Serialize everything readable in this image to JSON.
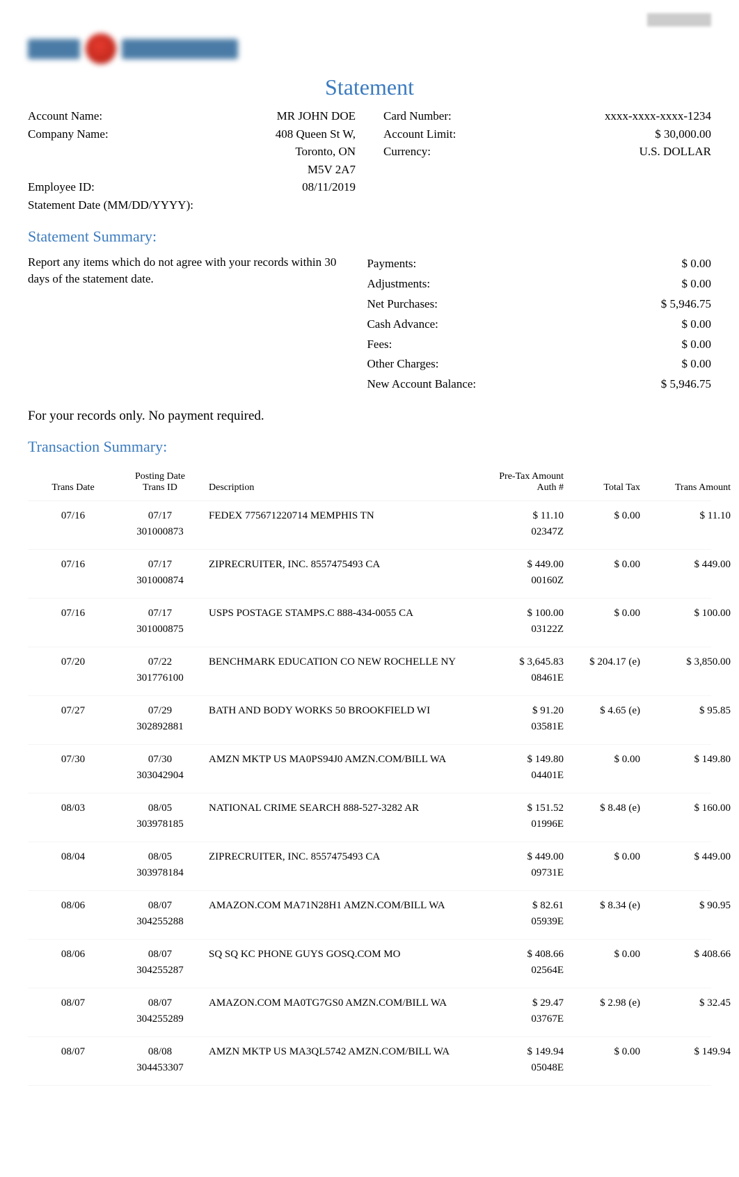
{
  "top_right_blurred": "x: redacted-url",
  "logo_text_left": "Blur",
  "logo_text_right": "Financial Group",
  "title": "Statement",
  "account_info_left": [
    {
      "label": "Account Name:",
      "value_lines": [
        "MR JOHN DOE"
      ]
    },
    {
      "label": "Company Name:",
      "value_lines": [
        "408 Queen St W,",
        "Toronto, ON",
        "M5V 2A7"
      ]
    },
    {
      "label": "Employee ID:",
      "value_lines": [
        "08/11/2019"
      ]
    },
    {
      "label": "Statement Date (MM/DD/YYYY):",
      "value_lines": [
        ""
      ]
    }
  ],
  "account_info_right": [
    {
      "label": "Card Number:",
      "value_lines": [
        "xxxx-xxxx-xxxx-1234"
      ]
    },
    {
      "label": "Account Limit:",
      "value_lines": [
        "$ 30,000.00"
      ]
    },
    {
      "label": "",
      "value_lines": [
        ""
      ]
    },
    {
      "label": "",
      "value_lines": [
        ""
      ]
    },
    {
      "label": "Currency:",
      "value_lines": [
        "U.S. DOLLAR"
      ]
    }
  ],
  "summary_heading": "Statement Summary:",
  "summary_note": "Report any items which do not agree with your records within 30 days of the statement date.",
  "summary_rows": [
    {
      "label": "Payments:",
      "value": "$ 0.00"
    },
    {
      "label": "Adjustments:",
      "value": "$ 0.00"
    },
    {
      "label": "Net Purchases:",
      "value": "$ 5,946.75"
    },
    {
      "label": "Cash Advance:",
      "value": "$ 0.00"
    },
    {
      "label": "Fees:",
      "value": "$ 0.00"
    },
    {
      "label": "Other Charges:",
      "value": "$ 0.00"
    },
    {
      "label": "New Account Balance:",
      "value": "$ 5,946.75"
    }
  ],
  "records_note": "For your records only. No payment required.",
  "tx_heading": "Transaction Summary:",
  "tx_headers": {
    "trans_date": "Trans Date",
    "posting_date": "Posting Date",
    "trans_id": "Trans ID",
    "description": "Description",
    "pre_tax": "Pre-Tax Amount",
    "auth": "Auth #",
    "total_tax": "Total Tax",
    "trans_amount": "Trans Amount"
  },
  "transactions": [
    {
      "trans_date": "07/16",
      "posting_date": "07/17",
      "trans_id": "301000873",
      "description": "FEDEX 775671220714 MEMPHIS TN",
      "pre_tax": "$ 11.10",
      "auth": "02347Z",
      "total_tax": "$ 0.00",
      "trans_amount": "$ 11.10"
    },
    {
      "trans_date": "07/16",
      "posting_date": "07/17",
      "trans_id": "301000874",
      "description": "ZIPRECRUITER, INC. 8557475493 CA",
      "pre_tax": "$ 449.00",
      "auth": "00160Z",
      "total_tax": "$ 0.00",
      "trans_amount": "$ 449.00"
    },
    {
      "trans_date": "07/16",
      "posting_date": "07/17",
      "trans_id": "301000875",
      "description": "USPS POSTAGE STAMPS.C 888-434-0055 CA",
      "pre_tax": "$ 100.00",
      "auth": "03122Z",
      "total_tax": "$ 0.00",
      "trans_amount": "$ 100.00"
    },
    {
      "trans_date": "07/20",
      "posting_date": "07/22",
      "trans_id": "301776100",
      "description": "BENCHMARK EDUCATION CO NEW ROCHELLE NY",
      "pre_tax": "$ 3,645.83",
      "auth": "08461E",
      "total_tax": "$ 204.17 (e)",
      "trans_amount": "$ 3,850.00"
    },
    {
      "trans_date": "07/27",
      "posting_date": "07/29",
      "trans_id": "302892881",
      "description": "BATH AND BODY WORKS 50 BROOKFIELD WI",
      "pre_tax": "$ 91.20",
      "auth": "03581E",
      "total_tax": "$ 4.65 (e)",
      "trans_amount": "$ 95.85"
    },
    {
      "trans_date": "07/30",
      "posting_date": "07/30",
      "trans_id": "303042904",
      "description": "AMZN MKTP US MA0PS94J0 AMZN.COM/BILL WA",
      "pre_tax": "$ 149.80",
      "auth": "04401E",
      "total_tax": "$ 0.00",
      "trans_amount": "$ 149.80"
    },
    {
      "trans_date": "08/03",
      "posting_date": "08/05",
      "trans_id": "303978185",
      "description": "NATIONAL CRIME SEARCH 888-527-3282 AR",
      "pre_tax": "$ 151.52",
      "auth": "01996E",
      "total_tax": "$ 8.48 (e)",
      "trans_amount": "$ 160.00"
    },
    {
      "trans_date": "08/04",
      "posting_date": "08/05",
      "trans_id": "303978184",
      "description": "ZIPRECRUITER, INC. 8557475493 CA",
      "pre_tax": "$ 449.00",
      "auth": "09731E",
      "total_tax": "$ 0.00",
      "trans_amount": "$ 449.00"
    },
    {
      "trans_date": "08/06",
      "posting_date": "08/07",
      "trans_id": "304255288",
      "description": "AMAZON.COM MA71N28H1 AMZN.COM/BILL WA",
      "pre_tax": "$ 82.61",
      "auth": "05939E",
      "total_tax": "$ 8.34 (e)",
      "trans_amount": "$ 90.95"
    },
    {
      "trans_date": "08/06",
      "posting_date": "08/07",
      "trans_id": "304255287",
      "description": "SQ SQ KC PHONE GUYS GOSQ.COM MO",
      "pre_tax": "$ 408.66",
      "auth": "02564E",
      "total_tax": "$ 0.00",
      "trans_amount": "$ 408.66"
    },
    {
      "trans_date": "08/07",
      "posting_date": "08/07",
      "trans_id": "304255289",
      "description": "AMAZON.COM MA0TG7GS0 AMZN.COM/BILL WA",
      "pre_tax": "$ 29.47",
      "auth": "03767E",
      "total_tax": "$ 2.98 (e)",
      "trans_amount": "$ 32.45"
    },
    {
      "trans_date": "08/07",
      "posting_date": "08/08",
      "trans_id": "304453307",
      "description": "AMZN MKTP US MA3QL5742 AMZN.COM/BILL WA",
      "pre_tax": "$ 149.94",
      "auth": "05048E",
      "total_tax": "$ 0.00",
      "trans_amount": "$ 149.94"
    }
  ]
}
